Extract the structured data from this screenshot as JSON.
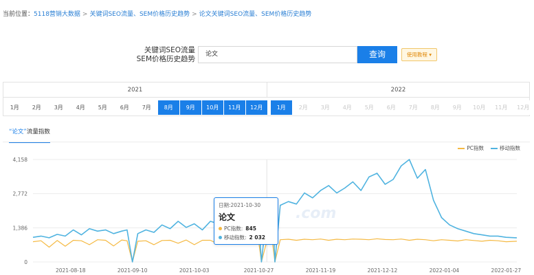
{
  "breadcrumb": {
    "prefix": "当前位置：",
    "items": [
      "5118营销大数据",
      "关键词SEO流量、SEM价格历史趋势",
      "论文关键词SEO流量、SEM价格历史趋势"
    ]
  },
  "query": {
    "label_line1": "关键词SEO流量",
    "label_line2": "SEM价格历史趋势",
    "input_value": "论文",
    "search_label": "查询",
    "help_label": "使用教程 ▾"
  },
  "years": [
    "2021",
    "2022"
  ],
  "months_2021": [
    {
      "label": "1月",
      "state": "normal"
    },
    {
      "label": "2月",
      "state": "normal"
    },
    {
      "label": "3月",
      "state": "normal"
    },
    {
      "label": "4月",
      "state": "normal"
    },
    {
      "label": "5月",
      "state": "normal"
    },
    {
      "label": "6月",
      "state": "normal"
    },
    {
      "label": "7月",
      "state": "normal"
    },
    {
      "label": "8月",
      "state": "selected"
    },
    {
      "label": "9月",
      "state": "selected"
    },
    {
      "label": "10月",
      "state": "selected"
    },
    {
      "label": "11月",
      "state": "selected"
    },
    {
      "label": "12月",
      "state": "selected"
    }
  ],
  "months_2022": [
    {
      "label": "1月",
      "state": "selected"
    },
    {
      "label": "2月",
      "state": "disabled"
    },
    {
      "label": "3月",
      "state": "disabled"
    },
    {
      "label": "4月",
      "state": "disabled"
    },
    {
      "label": "5月",
      "state": "disabled"
    },
    {
      "label": "6月",
      "state": "disabled"
    },
    {
      "label": "7月",
      "state": "disabled"
    },
    {
      "label": "8月",
      "state": "disabled"
    },
    {
      "label": "9月",
      "state": "disabled"
    },
    {
      "label": "10月",
      "state": "disabled"
    },
    {
      "label": "11月",
      "state": "disabled"
    },
    {
      "label": "12月",
      "state": "disabled"
    }
  ],
  "tab": {
    "keyword": "“论文”",
    "label": "流量指数"
  },
  "tooltip": {
    "date": "日期:2021-10-30",
    "keyword": "论文",
    "pc_label": "PC指数:",
    "pc_value": "845",
    "mobile_label": "移动指数:",
    "mobile_value": "2 032"
  },
  "watermark": ".com",
  "colors": {
    "accent": "#1a7fe8",
    "pc": "#f5b942",
    "mobile": "#4fb3e0"
  },
  "chart_data": {
    "type": "line",
    "title": "",
    "xlabel": "",
    "ylabel": "",
    "ylim": [
      0,
      4158
    ],
    "yticks": [
      "0",
      "1,386",
      "2,772",
      "4,158"
    ],
    "xticks": [
      "2021-08-18",
      "2021-09-10",
      "2021-10-03",
      "2021-10-27",
      "2021-11-19",
      "2021-12-12",
      "2022-01-04",
      "2022-01-27"
    ],
    "x": [
      "2021-08-04",
      "2021-08-07",
      "2021-08-10",
      "2021-08-13",
      "2021-08-16",
      "2021-08-19",
      "2021-08-22",
      "2021-08-25",
      "2021-08-28",
      "2021-08-31",
      "2021-09-03",
      "2021-09-06",
      "2021-09-08",
      "2021-09-10",
      "2021-09-12",
      "2021-09-15",
      "2021-09-18",
      "2021-09-21",
      "2021-09-24",
      "2021-09-27",
      "2021-09-30",
      "2021-10-03",
      "2021-10-06",
      "2021-10-09",
      "2021-10-12",
      "2021-10-15",
      "2021-10-18",
      "2021-10-21",
      "2021-10-24",
      "2021-10-27",
      "2021-10-28",
      "2021-10-30",
      "2021-11-01",
      "2021-11-02",
      "2021-11-04",
      "2021-11-07",
      "2021-11-10",
      "2021-11-13",
      "2021-11-16",
      "2021-11-19",
      "2021-11-22",
      "2021-11-25",
      "2021-11-28",
      "2021-12-01",
      "2021-12-04",
      "2021-12-07",
      "2021-12-10",
      "2021-12-13",
      "2021-12-16",
      "2021-12-19",
      "2021-12-22",
      "2021-12-25",
      "2021-12-28",
      "2021-12-31",
      "2022-01-03",
      "2022-01-06",
      "2022-01-09",
      "2022-01-12",
      "2022-01-15",
      "2022-01-18",
      "2022-01-21",
      "2022-01-24",
      "2022-01-27",
      "2022-01-31"
    ],
    "series": [
      {
        "name": "PC指数",
        "color": "#f5b942",
        "values": [
          820,
          860,
          600,
          870,
          640,
          880,
          860,
          700,
          900,
          880,
          650,
          890,
          860,
          0,
          840,
          860,
          700,
          870,
          880,
          760,
          890,
          700,
          880,
          880,
          720,
          900,
          880,
          720,
          890,
          800,
          0,
          845,
          880,
          0,
          900,
          920,
          880,
          920,
          900,
          930,
          880,
          920,
          900,
          930,
          920,
          900,
          940,
          910,
          900,
          930,
          880,
          920,
          900,
          860,
          900,
          880,
          850,
          900,
          870,
          840,
          880,
          860,
          820,
          840
        ]
      },
      {
        "name": "移动指数",
        "color": "#4fb3e0",
        "values": [
          1000,
          1050,
          980,
          1120,
          1050,
          1300,
          1100,
          1350,
          1250,
          1300,
          1150,
          1250,
          1300,
          0,
          1150,
          1300,
          1200,
          1500,
          1350,
          1650,
          1400,
          1550,
          1300,
          1650,
          1550,
          1150,
          1750,
          1700,
          1900,
          1650,
          0,
          2032,
          2500,
          0,
          2300,
          2450,
          2350,
          2800,
          2600,
          2900,
          3100,
          2800,
          3000,
          3250,
          2900,
          3450,
          3600,
          3150,
          3350,
          3900,
          4158,
          3400,
          3750,
          2500,
          1800,
          1500,
          1350,
          1250,
          1150,
          1100,
          1050,
          1050,
          1000,
          980
        ]
      }
    ],
    "legend": "top-right"
  }
}
